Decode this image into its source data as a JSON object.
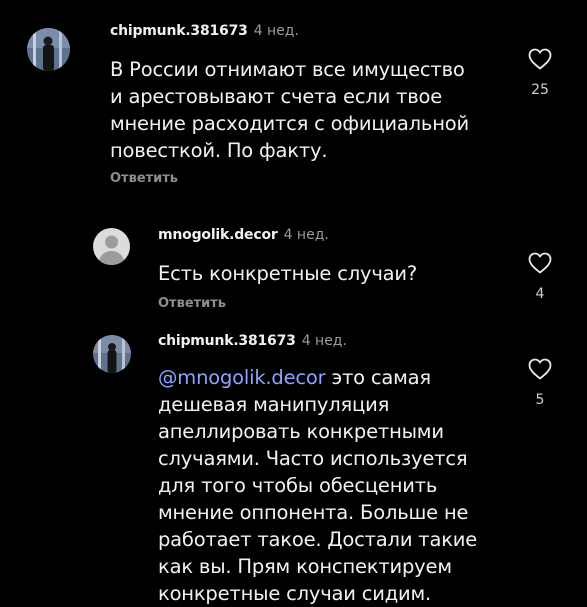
{
  "comments": [
    {
      "username": "chipmunk.381673",
      "time": "4 нед.",
      "lines": [
        "В России отнимают все имущество",
        "и арестовывают счета если твое",
        "мнение расходится с официальной",
        "повесткой. По факту."
      ],
      "reply_label": "Ответить",
      "likes": "25"
    },
    {
      "username": "mnogolik.decor",
      "time": "4 нед.",
      "lines": [
        "Есть конкретные случаи?"
      ],
      "reply_label": "Ответить",
      "likes": "4"
    },
    {
      "username": "chipmunk.381673",
      "time": "4 нед.",
      "mention": "@mnogolik.decor",
      "first_line_rest": " это самая",
      "lines": [
        "дешевая манипуляция",
        "апеллировать конкретными",
        "случаями. Часто используется",
        "для того чтобы обесценить",
        "мнение оппонента. Больше не",
        "работает такое. Достали такие",
        "как вы. Прям конспектируем",
        "конкретные случаи сидим."
      ],
      "likes": "5"
    }
  ],
  "colors": {
    "background": "#000000",
    "text": "#f2f2f2",
    "muted": "#9a9a9a",
    "mention": "#8ea2ff"
  },
  "icons": {
    "like": "heart-outline-icon",
    "default_avatar": "default-avatar-icon"
  }
}
